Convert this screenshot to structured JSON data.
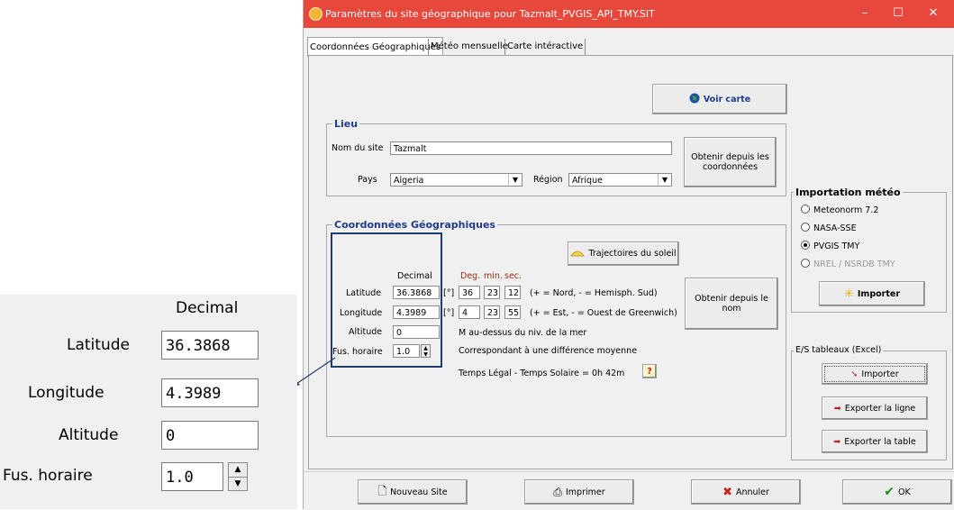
{
  "window": {
    "title": "Paramètres du site géographique pour Tazmalt_PVGIS_API_TMY.SIT",
    "minimize": "–",
    "maximize": "☐",
    "close": "✕"
  },
  "tabs": [
    "Coordonnées Géographiques",
    "Météo mensuelle",
    "Carte intéractive"
  ],
  "voir_carte": "Voir carte",
  "lieu": {
    "title": "Lieu",
    "site_label": "Nom du site",
    "site_value": "Tazmalt",
    "pays_label": "Pays",
    "pays_value": "Algeria",
    "region_label": "Région",
    "region_value": "Afrique",
    "obtenir_coord": "Obtenir depuis les coordonnées"
  },
  "coords": {
    "title": "Coordonnées Géographiques",
    "trajectoires": "Trajectoires du soleil",
    "decimal_header": "Decimal",
    "deg_header": "Deg.",
    "min_header": "min.",
    "sec_header": "sec.",
    "latitude_label": "Latitude",
    "latitude_decimal": "36.3868",
    "latitude_deg": "36",
    "latitude_min": "23",
    "latitude_sec": "12",
    "latitude_note": "(+ = Nord, - = Hemisph. Sud)",
    "longitude_label": "Longitude",
    "longitude_decimal": "4.3989",
    "longitude_deg": "4",
    "longitude_min": "23",
    "longitude_sec": "55",
    "longitude_note": "(+ = Est, - = Ouest de Greenwich)",
    "deg_symbol": "[°]",
    "altitude_label": "Altitude",
    "altitude_value": "0",
    "altitude_note": "M au-dessus du niv. de la mer",
    "fus_label": "Fus. horaire",
    "fus_value": "1.0",
    "fus_note": "Correspondant à une différence moyenne",
    "temps_legal": "Temps Légal - Temps Solaire =   0h 42m",
    "help": "?",
    "obtenir_nom": "Obtenir depuis le nom"
  },
  "import": {
    "title": "Importation météo",
    "options": [
      "Meteonorm 7.2",
      "NASA-SSE",
      "PVGIS TMY",
      "NREL / NSRDB TMY"
    ],
    "selected": "PVGIS TMY",
    "button": "Importer"
  },
  "es": {
    "title": "E/S tableaux (Excel)",
    "importer": "Importer",
    "exporter_ligne": "Exporter la ligne",
    "exporter_table": "Exporter la table"
  },
  "bottom": {
    "nouveau": "Nouveau Site",
    "imprimer": "Imprimer",
    "annuler": "Annuler",
    "ok": "OK"
  },
  "zoom": {
    "decimal_header": "Decimal",
    "latitude_label": "Latitude",
    "latitude_value": "36.3868",
    "longitude_label": "Longitude",
    "longitude_value": "4.3989",
    "altitude_label": "Altitude",
    "altitude_value": "0",
    "fus_label": "Fus. horaire",
    "fus_value": "1.0"
  },
  "colors": {
    "titlebar": "#e8473c",
    "group_title": "#1f3b8c",
    "highlight": "#1f3b73"
  }
}
